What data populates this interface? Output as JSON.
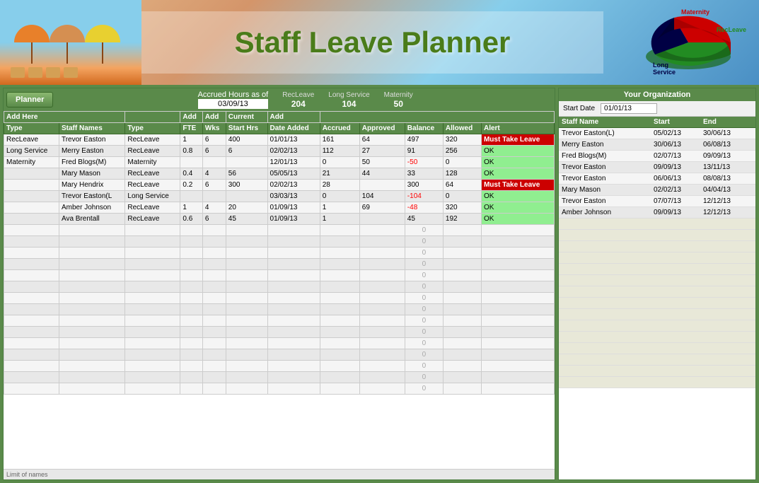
{
  "header": {
    "title": "Staff Leave Planner"
  },
  "topBar": {
    "plannerBtn": "Planner",
    "accruedLabel": "Accrued Hours as of",
    "accruedDate": "03/09/13",
    "recleaveLabel": "RecLeave",
    "recleaveValue": "204",
    "longServiceLabel": "Long Service",
    "longServiceValue": "104",
    "maternityLabel": "Maternity",
    "maternityValue": "50"
  },
  "tableHeaders": {
    "type": "Type",
    "staffNames": "Staff Names",
    "leaveType": "Type",
    "fte": "FTE",
    "wks": "Wks",
    "startHrs": "Start Hrs",
    "dateAdded": "Date Added",
    "accrued": "Accrued",
    "approved": "Approved",
    "balance": "Balance",
    "allowed": "Allowed",
    "alert": "Alert"
  },
  "addHeaders": {
    "addHere": "Add Here",
    "addFte": "Add",
    "addWks": "Add",
    "current": "Current",
    "add": "Add"
  },
  "tableRows": [
    {
      "type": "RecLeave",
      "name": "Trevor Easton",
      "leaveType": "RecLeave",
      "fte": "1",
      "wks": "6",
      "startHrs": "400",
      "dateAdded": "01/01/13",
      "accrued": "161",
      "approved": "64",
      "balance": "497",
      "allowed": "320",
      "alert": "Must Take Leave",
      "alertClass": "alert-must"
    },
    {
      "type": "Long Service",
      "name": "Merry Easton",
      "leaveType": "RecLeave",
      "fte": "0.8",
      "wks": "6",
      "startHrs": "6",
      "dateAdded": "02/02/13",
      "accrued": "112",
      "approved": "27",
      "balance": "91",
      "allowed": "256",
      "alert": "OK",
      "alertClass": "alert-ok"
    },
    {
      "type": "Maternity",
      "name": "Fred Blogs(M)",
      "leaveType": "Maternity",
      "fte": "",
      "wks": "",
      "startHrs": "",
      "dateAdded": "12/01/13",
      "accrued": "0",
      "approved": "50",
      "balance": "-50",
      "allowed": "0",
      "alert": "OK",
      "alertClass": "alert-ok",
      "balanceNeg": true
    },
    {
      "type": "",
      "name": "Mary Mason",
      "leaveType": "RecLeave",
      "fte": "0.4",
      "wks": "4",
      "startHrs": "56",
      "dateAdded": "05/05/13",
      "accrued": "21",
      "approved": "44",
      "balance": "33",
      "allowed": "128",
      "alert": "OK",
      "alertClass": "alert-ok"
    },
    {
      "type": "",
      "name": "Mary Hendrix",
      "leaveType": "RecLeave",
      "fte": "0.2",
      "wks": "6",
      "startHrs": "300",
      "dateAdded": "02/02/13",
      "accrued": "28",
      "approved": "",
      "balance": "300",
      "allowed": "64",
      "alert": "Must Take Leave",
      "alertClass": "alert-must"
    },
    {
      "type": "",
      "name": "Trevor Easton(L",
      "leaveType": "Long Service",
      "fte": "",
      "wks": "",
      "startHrs": "",
      "dateAdded": "03/03/13",
      "accrued": "0",
      "approved": "104",
      "balance": "-104",
      "allowed": "0",
      "alert": "OK",
      "alertClass": "alert-ok",
      "balanceNeg": true
    },
    {
      "type": "",
      "name": "Amber Johnson",
      "leaveType": "RecLeave",
      "fte": "1",
      "wks": "4",
      "startHrs": "20",
      "dateAdded": "01/09/13",
      "accrued": "1",
      "approved": "69",
      "balance": "-48",
      "allowed": "320",
      "alert": "OK",
      "alertClass": "alert-ok",
      "balanceNeg": true
    },
    {
      "type": "",
      "name": "Ava Brentall",
      "leaveType": "RecLeave",
      "fte": "0.6",
      "wks": "6",
      "startHrs": "45",
      "dateAdded": "01/09/13",
      "accrued": "1",
      "approved": "",
      "balance": "45",
      "allowed": "192",
      "alert": "OK",
      "alertClass": "alert-ok"
    }
  ],
  "emptyRows": 15,
  "limitText": "Limit of names",
  "rightPanel": {
    "title": "Your Organization",
    "startDateLabel": "Start Date",
    "startDateValue": "01/01/13",
    "headers": {
      "staffName": "Staff Name",
      "start": "Start",
      "end": "End"
    },
    "rows": [
      {
        "name": "Trevor Easton(L)",
        "start": "05/02/13",
        "end": "30/06/13"
      },
      {
        "name": "Merry Easton",
        "start": "30/06/13",
        "end": "06/08/13"
      },
      {
        "name": "Fred Blogs(M)",
        "start": "02/07/13",
        "end": "09/09/13"
      },
      {
        "name": "Trevor Easton",
        "start": "09/09/13",
        "end": "13/11/13"
      },
      {
        "name": "Trevor Easton",
        "start": "06/06/13",
        "end": "08/08/13"
      },
      {
        "name": "Mary Mason",
        "start": "02/02/13",
        "end": "04/04/13"
      },
      {
        "name": "Trevor Easton",
        "start": "07/07/13",
        "end": "12/12/13"
      },
      {
        "name": "Amber Johnson",
        "start": "09/09/13",
        "end": "12/12/13"
      }
    ],
    "emptyRows": 15
  },
  "chart": {
    "segments": [
      {
        "label": "Maternity",
        "color": "#cc0000",
        "value": 50
      },
      {
        "label": "Long Service",
        "color": "#000044",
        "value": 104
      },
      {
        "label": "RecLeave",
        "color": "#228B22",
        "value": 204
      }
    ],
    "total": 358
  }
}
